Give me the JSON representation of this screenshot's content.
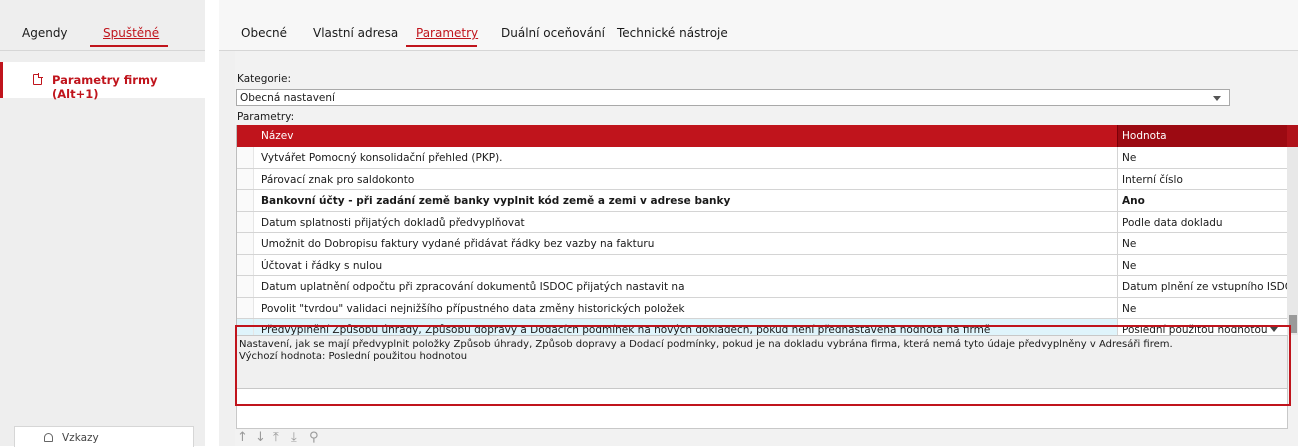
{
  "left": {
    "tabs": [
      {
        "label": "Agendy",
        "active": false
      },
      {
        "label": "Spuštěné",
        "active": true
      }
    ],
    "item": {
      "label": "Parametry firmy (Alt+1)",
      "icon": "document-icon"
    },
    "bottom_button": {
      "label": "Vzkazy",
      "icon": "bell-icon"
    }
  },
  "right": {
    "tabs": [
      {
        "label": "Obecné",
        "active": false
      },
      {
        "label": "Vlastní adresa",
        "active": false
      },
      {
        "label": "Parametry",
        "active": true
      },
      {
        "label": "Duální oceňování",
        "active": false
      },
      {
        "label": "Technické nástroje",
        "active": false
      }
    ]
  },
  "form": {
    "category_label": "Kategorie:",
    "category_value": "Obecná nastavení",
    "params_label": "Parametry:"
  },
  "grid": {
    "columns": [
      "Název",
      "Hodnota"
    ],
    "rows": [
      {
        "name": "Vytvářet Pomocný konsolidační přehled (PKP).",
        "value": "Ne",
        "bold": false
      },
      {
        "name": "Párovací znak pro saldokonto",
        "value": "Interní číslo",
        "bold": false
      },
      {
        "name": "Bankovní účty - při zadání země banky vyplnit kód země a zemi v adrese banky",
        "value": "Ano",
        "bold": true
      },
      {
        "name": "Datum splatnosti přijatých dokladů předvyplňovat",
        "value": "Podle data dokladu",
        "bold": false
      },
      {
        "name": "Umožnit do Dobropisu faktury vydané přidávat řádky bez vazby na fakturu",
        "value": "Ne",
        "bold": false
      },
      {
        "name": "Účtovat i řádky s nulou",
        "value": "Ne",
        "bold": false
      },
      {
        "name": "Datum uplatnění odpočtu při zpracování dokumentů ISDOC přijatých nastavit na",
        "value": "Datum plnění ze vstupního ISDOC",
        "bold": false
      },
      {
        "name": "Povolit \"tvrdou\" validaci nejnižšího přípustného data změny historických položek",
        "value": "Ne",
        "bold": false
      },
      {
        "name": "Předvyplnění Způsobu úhrady, Způsobu dopravy a Dodacích podmínek na nových dokladech, pokud není přednastavena hodnota na firmě",
        "value": "Poslední použitou hodnotou",
        "bold": false,
        "selected": true
      }
    ]
  },
  "description": {
    "line1": "Nastavení, jak se mají předvyplnit položky Způsob úhrady, Způsob dopravy a Dodací podmínky, pokud je na dokladu vybrána firma, která nemá tyto údaje předvyplněny v Adresáři firem.",
    "line2": "Výchozí hodnota: Poslední použitou hodnotou"
  },
  "toolbar": {
    "up": "↑",
    "down": "↓",
    "top": "⤒",
    "bottom": "⤓",
    "search": "⚲"
  },
  "colors": {
    "accent": "#c0141c",
    "header_dark": "#9c0a12",
    "selected_row": "#dff4fb"
  }
}
